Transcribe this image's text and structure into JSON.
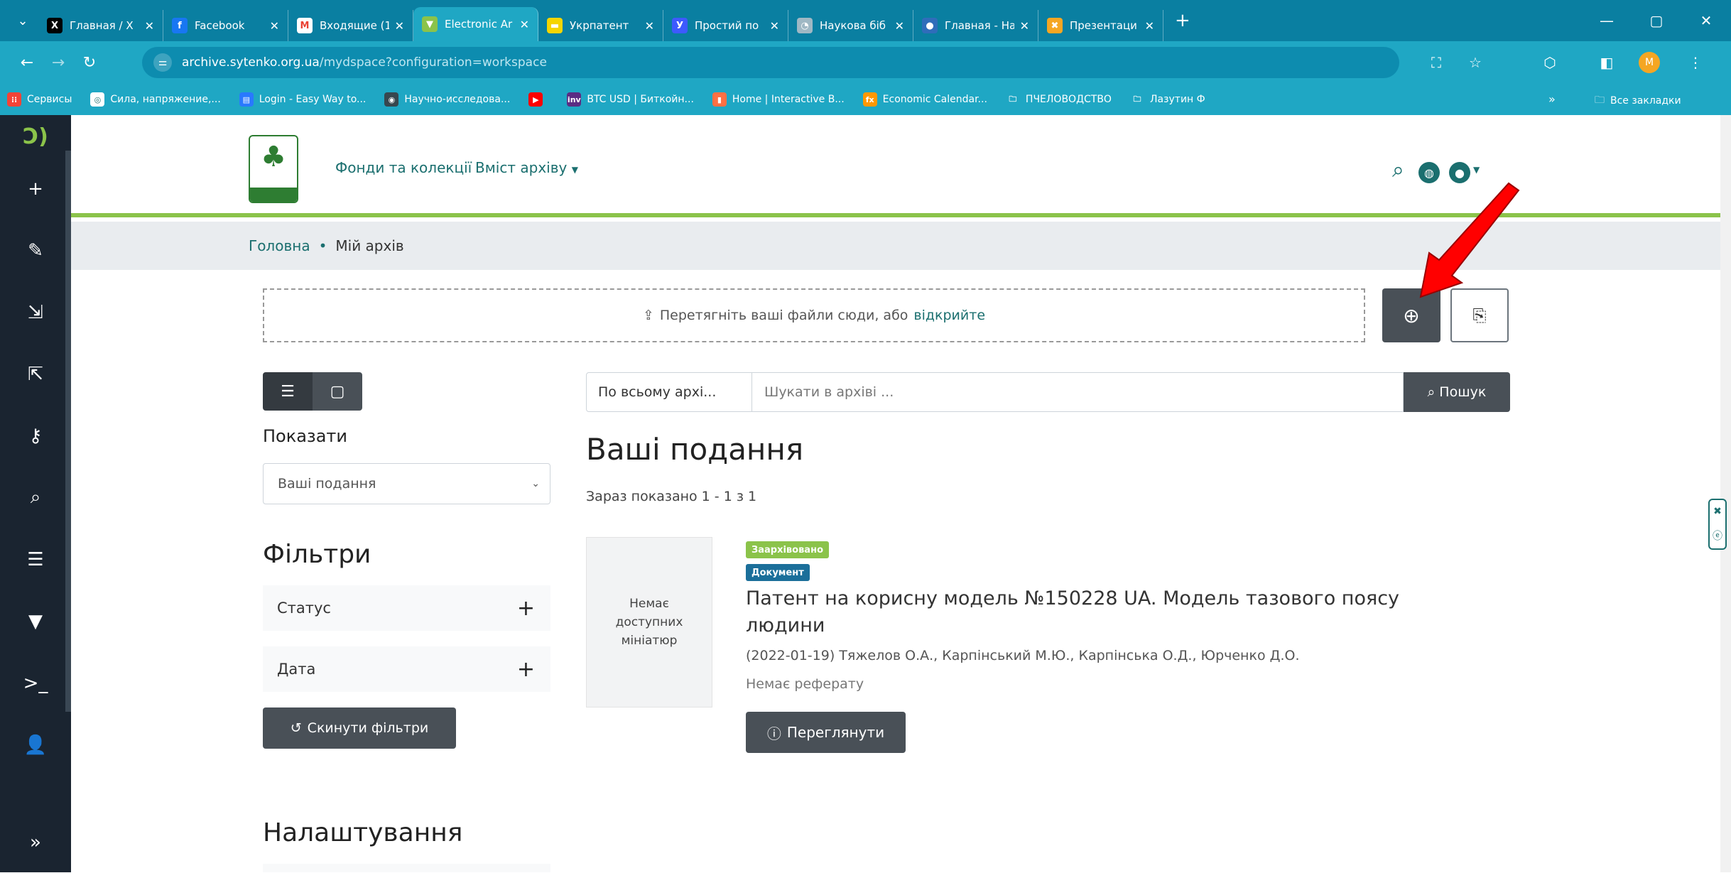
{
  "browser": {
    "tabs": [
      {
        "label": "Главная / X",
        "icon": "x-logo-icon",
        "fav_bg": "#000000",
        "glyph": "X"
      },
      {
        "label": "Facebook",
        "icon": "facebook-icon",
        "fav_bg": "#1877f2",
        "glyph": "f"
      },
      {
        "label": "Входящие (1",
        "icon": "gmail-icon",
        "fav_bg": "#ffffff",
        "glyph": "M"
      },
      {
        "label": "Electronic Ar",
        "icon": "dspace-tab-icon",
        "fav_bg": "#8bc34a",
        "glyph": "▼"
      },
      {
        "label": "Укрпатент",
        "icon": "ukrpatent-icon",
        "fav_bg": "#f5d500",
        "glyph": "▬"
      },
      {
        "label": "Простий по",
        "icon": "yandex-icon",
        "fav_bg": "#3d5afe",
        "glyph": "У"
      },
      {
        "label": "Наукова біб",
        "icon": "library-icon",
        "fav_bg": "#9fb8c4",
        "glyph": "◔"
      },
      {
        "label": "Главная - На",
        "icon": "globe-tab-icon",
        "fav_bg": "#2f6dba",
        "glyph": "●"
      },
      {
        "label": "Презентаци",
        "icon": "slides-icon",
        "fav_bg": "#f5a623",
        "glyph": "✖"
      }
    ],
    "address": {
      "host": "archive.sytenko.org.ua",
      "path": "/mydspace?configuration=workspace"
    },
    "bookmarks": [
      {
        "label": "Сервисы",
        "icon": "apps-grid-icon",
        "bg": "#f44336",
        "glyph": "⁝⁝"
      },
      {
        "label": "Сила, напряжение,...",
        "icon": "bookmark-site-icon",
        "bg": "#ffffff",
        "glyph": "◎"
      },
      {
        "label": "Login - Easy Way to...",
        "icon": "bookmark-login-icon",
        "bg": "#2979ff",
        "glyph": "▤"
      },
      {
        "label": "Научно-исследова...",
        "icon": "bookmark-globe-icon",
        "bg": "#37474f",
        "glyph": "◉"
      },
      {
        "label": "",
        "icon": "youtube-icon",
        "bg": "#ff0000",
        "glyph": "▶"
      },
      {
        "label": "BTC USD | Биткойн...",
        "icon": "bookmark-invest-icon",
        "bg": "#5b2c83",
        "glyph": "inv"
      },
      {
        "label": "Home | Interactive B...",
        "icon": "bookmark-ib-icon",
        "bg": "#ff7043",
        "glyph": "▮"
      },
      {
        "label": "Economic Calendar...",
        "icon": "bookmark-fx-icon",
        "bg": "#ff9800",
        "glyph": "fx"
      },
      {
        "label": "ПЧЕЛОВОДСТВО",
        "icon": "folder-icon",
        "bg": "transparent",
        "glyph": "🗀"
      },
      {
        "label": "Лазутин Ф",
        "icon": "folder-icon",
        "bg": "transparent",
        "glyph": "🗀"
      }
    ],
    "bookmarks_more": "»",
    "all_bookmarks": "Все закладки",
    "profile_initial": "M"
  },
  "header": {
    "nav_communities": "Фонди та колекції",
    "nav_browse": "Вміст архіву"
  },
  "breadcrumb": {
    "home": "Головна",
    "separator": "•",
    "current": "Мій архів"
  },
  "dropzone": {
    "text": "Перетягніть ваші файли сюди, або",
    "link": "відкрийте"
  },
  "search": {
    "scope": "По всьому архі...",
    "placeholder": "Шукати в архіві ...",
    "button": "Пошук"
  },
  "sidebar": {
    "show_label": "Показати",
    "show_value": "Ваші подання",
    "filters_title": "Фільтри",
    "facets": [
      "Статус",
      "Дата"
    ],
    "reset_label": "Скинути фільтри",
    "settings_title": "Налаштування"
  },
  "results": {
    "title": "Ваші подання",
    "count": "Зараз показано 1 - 1 з 1",
    "item": {
      "thumb_text": "Немає доступних мініатюр",
      "badge_status": "Заархівовано",
      "badge_type": "Документ",
      "title": "Патент на корисну модель №150228 UA. Модель тазового поясу людини",
      "meta": "(2022-01-19) Тяжелов О.А., Карпінський М.Ю., Карпінська О.Д., Юрченко Д.О.",
      "abstract": "Немає реферату",
      "view_label": "Переглянути"
    }
  },
  "colors": {
    "accent": "#1b6f6f",
    "green": "#8bc34a",
    "dark_button": "#495057",
    "arrow": "#ff0000"
  }
}
